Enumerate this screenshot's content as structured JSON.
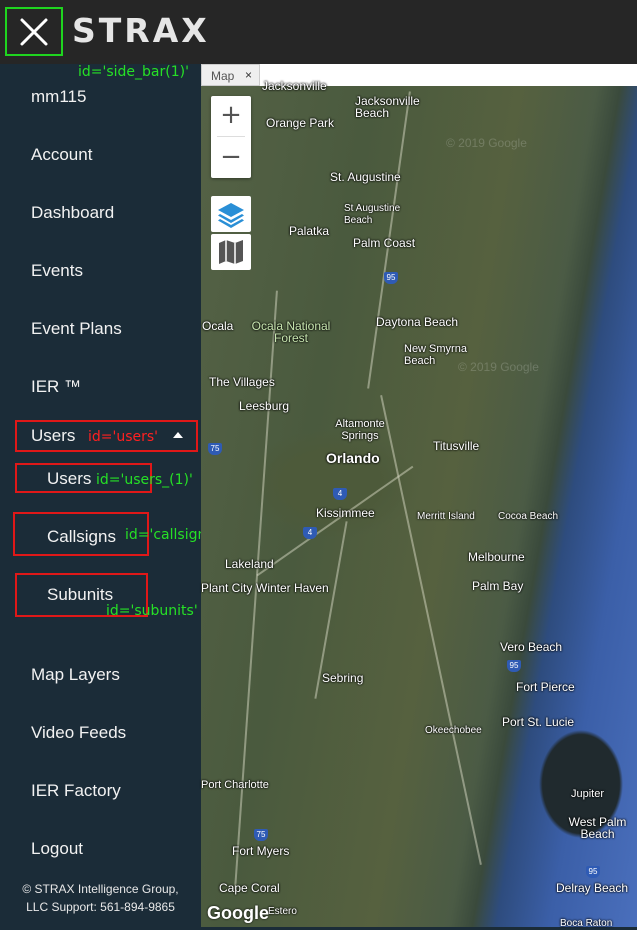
{
  "header": {
    "logo_text": "STRAX",
    "close_icon": "close-icon"
  },
  "annotations": {
    "side_bar": "id='side_bar(1)'",
    "users": "id='users'",
    "users_1": "id='users_(1)'",
    "callsigns": "id='callsigns'",
    "subunits": "id='subunits'"
  },
  "sidebar": {
    "username": "mm115",
    "items": [
      {
        "label": "Account"
      },
      {
        "label": "Dashboard"
      },
      {
        "label": "Events"
      },
      {
        "label": "Event Plans"
      },
      {
        "label": "IER ™"
      },
      {
        "label": "Users"
      }
    ],
    "submenu": [
      {
        "label": "Users"
      },
      {
        "label": "Callsigns"
      },
      {
        "label": "Subunits"
      }
    ],
    "lower_items": [
      {
        "label": "Map Layers"
      },
      {
        "label": "Video Feeds"
      },
      {
        "label": "IER Factory"
      },
      {
        "label": "Logout"
      }
    ],
    "footer_line1": "© STRAX Intelligence Group,",
    "footer_line2": "LLC Support: 561-894-9865"
  },
  "map": {
    "tab_label": "Map",
    "tab_close": "×",
    "zoom_in": "+",
    "zoom_out": "−",
    "attribution": "Google",
    "watermark": "© 2019 Google",
    "places": {
      "jacksonville": "Jacksonville",
      "jacksonville_beach": "Jacksonville Beach",
      "orange_park": "Orange Park",
      "st_augustine": "St. Augustine",
      "st_augustine_beach": "St Augustine Beach",
      "palatka": "Palatka",
      "palm_coast": "Palm Coast",
      "ocala": "Ocala",
      "ocala_forest": "Ocala National Forest",
      "daytona": "Daytona Beach",
      "new_smyrna": "New Smyrna Beach",
      "the_villages": "The Villages",
      "leesburg": "Leesburg",
      "altamonte": "Altamonte Springs",
      "titusville": "Titusville",
      "orlando": "Orlando",
      "kissimmee": "Kissimmee",
      "merritt": "Merritt Island",
      "cocoa": "Cocoa Beach",
      "lakeland": "Lakeland",
      "melbourne": "Melbourne",
      "plant_city": "Plant City",
      "winter_haven": "Winter Haven",
      "palm_bay": "Palm Bay",
      "vero": "Vero Beach",
      "sebring": "Sebring",
      "fort_pierce": "Fort Pierce",
      "port_st_lucie": "Port St. Lucie",
      "okeechobee": "Okeechobee",
      "port_charlotte": "Port Charlotte",
      "jupiter": "Jupiter",
      "west_palm": "West Palm Beach",
      "fort_myers": "Fort Myers",
      "cape_coral": "Cape Coral",
      "delray": "Delray Beach",
      "boca": "Boca Raton",
      "estero": "Estero"
    },
    "shields": {
      "i95": "95",
      "i75": "75",
      "i4": "4"
    }
  }
}
